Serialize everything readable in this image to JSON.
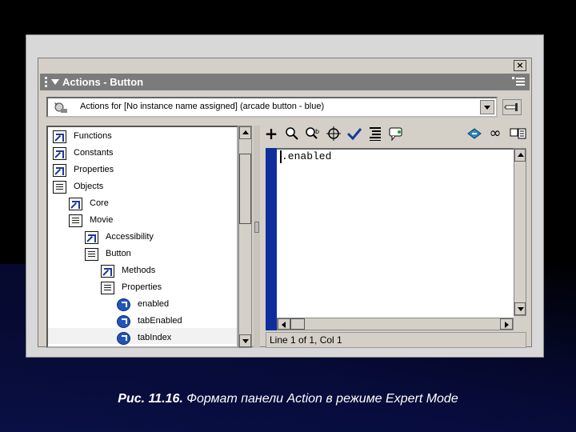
{
  "window": {
    "title": "Actions - Button",
    "close_label": "×"
  },
  "object_selector": {
    "value": "Actions for [No instance name assigned] (arcade button - blue)"
  },
  "toolbox": {
    "items": [
      {
        "label": "Functions",
        "icon": "book-icon"
      },
      {
        "label": "Constants",
        "icon": "book-icon"
      },
      {
        "label": "Properties",
        "icon": "book-icon"
      },
      {
        "label": "Objects",
        "icon": "folder-icon"
      },
      {
        "label": "Core",
        "icon": "book-icon"
      },
      {
        "label": "Movie",
        "icon": "folder-icon"
      },
      {
        "label": "Accessibility",
        "icon": "book-icon"
      },
      {
        "label": "Button",
        "icon": "folder-icon"
      },
      {
        "label": "Methods",
        "icon": "book-icon"
      },
      {
        "label": "Properties",
        "icon": "folder-icon"
      },
      {
        "label": "enabled",
        "icon": "property-icon"
      },
      {
        "label": "tabEnabled",
        "icon": "property-icon"
      },
      {
        "label": "tabIndex",
        "icon": "property-icon"
      }
    ]
  },
  "toolbar": {
    "add": "+",
    "find": "find-icon",
    "replace": "replace-icon",
    "target": "target-icon",
    "check_syntax": "check-icon",
    "format": "format-icon",
    "code_hints": "code-hint-icon",
    "debug_options": "debug-icon",
    "reference": "reference-icon",
    "view_options": "view-options-icon"
  },
  "editor": {
    "code": ".enabled"
  },
  "status": {
    "text": "Line 1 of 1, Col 1"
  },
  "caption": {
    "label": "Рис. 11.16.",
    "text": "Формат панели Action в режиме Expert Mode"
  },
  "colors": {
    "titlebar": "#7b7b7b",
    "gutter": "#0f2e9e",
    "panel": "#d4d0c8"
  }
}
